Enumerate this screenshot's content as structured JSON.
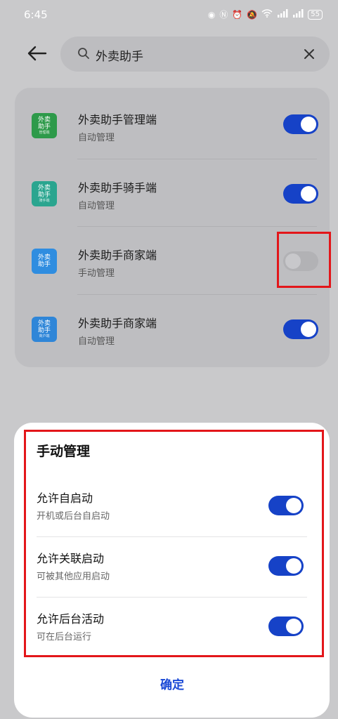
{
  "status_bar": {
    "time": "6:45",
    "icons": [
      "eye-icon",
      "nfc-icon",
      "alarm-icon",
      "mute-icon",
      "wifi-icon",
      "signal-icon"
    ],
    "battery": "55"
  },
  "search": {
    "value": "外卖助手",
    "placeholder": ""
  },
  "apps": [
    {
      "name": "外卖助手管理端",
      "mode": "自动管理",
      "enabled": true,
      "icon_color": "#2e9a4a",
      "icon_text": "外卖\n助手"
    },
    {
      "name": "外卖助手骑手端",
      "mode": "自动管理",
      "enabled": true,
      "icon_color": "#2aa58f",
      "icon_text": "外卖\n助手"
    },
    {
      "name": "外卖助手商家端",
      "mode": "手动管理",
      "enabled": false,
      "icon_color": "#2f8de0",
      "icon_text": "外卖\n助手"
    },
    {
      "name": "外卖助手商家端",
      "mode": "自动管理",
      "enabled": true,
      "icon_color": "#2f86d8",
      "icon_text": "外卖\n助手"
    }
  ],
  "sheet": {
    "title": "手动管理",
    "permissions": [
      {
        "title": "允许自启动",
        "desc": "开机或后台自启动",
        "enabled": true
      },
      {
        "title": "允许关联启动",
        "desc": "可被其他应用启动",
        "enabled": true
      },
      {
        "title": "允许后台活动",
        "desc": "可在后台运行",
        "enabled": true
      }
    ],
    "confirm_label": "确定"
  },
  "colors": {
    "accent": "#1642c7",
    "highlight": "#e3161a"
  }
}
